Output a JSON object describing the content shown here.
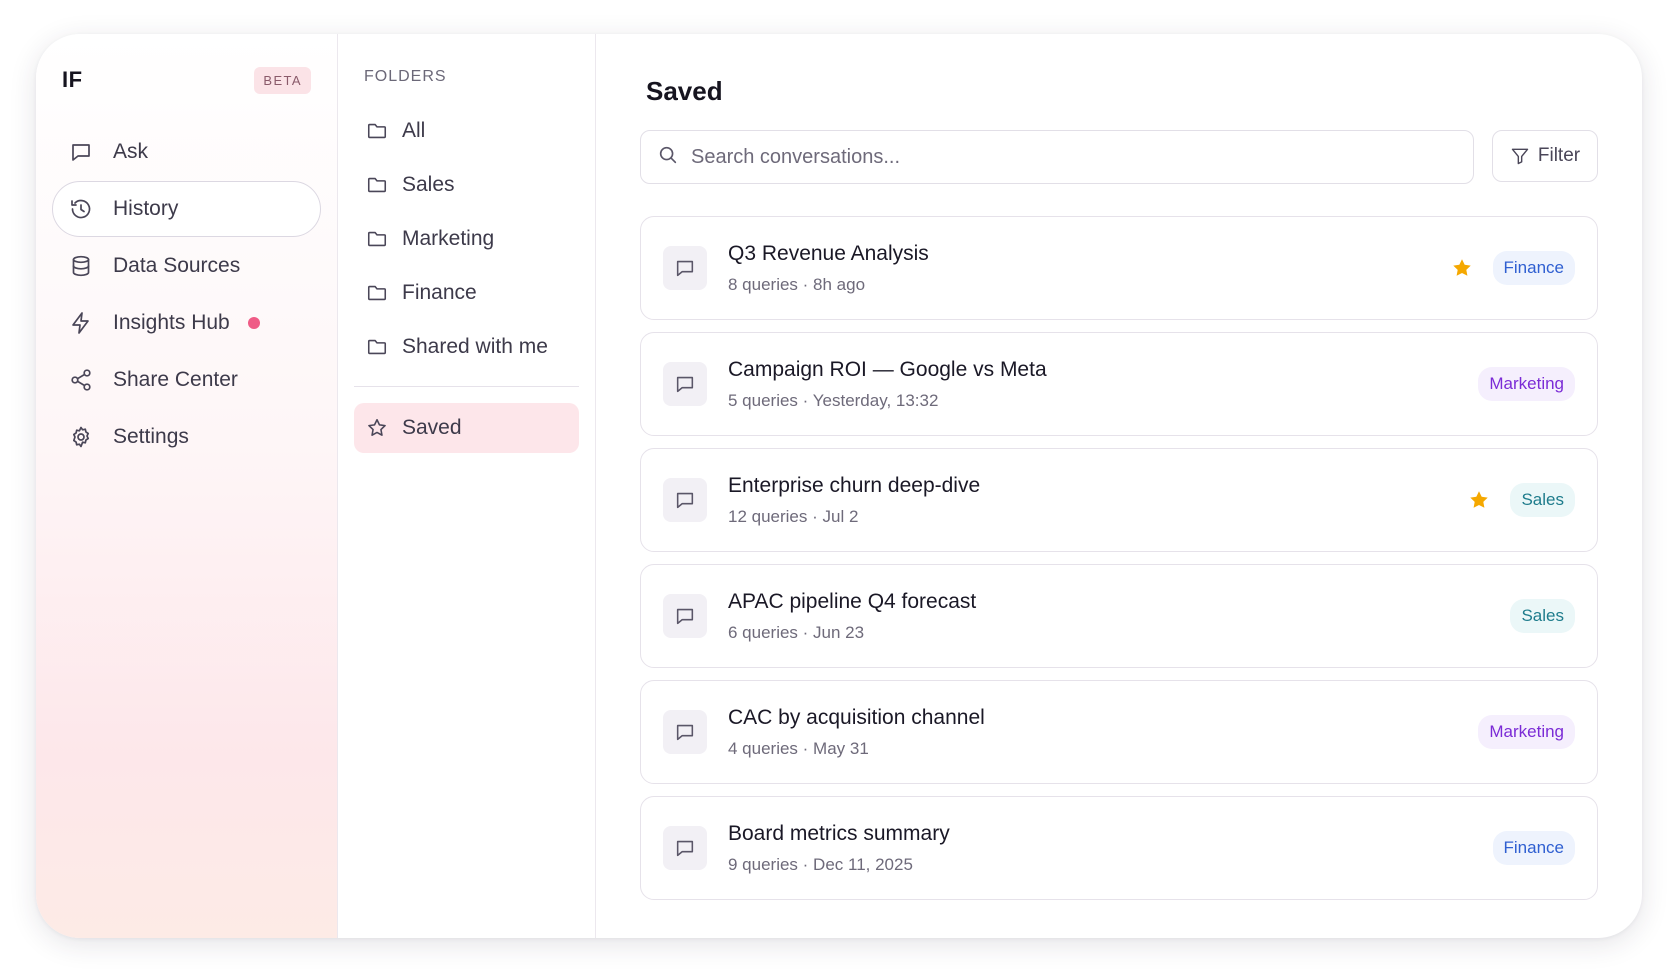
{
  "brand": {
    "logo": "IF",
    "badge": "BETA"
  },
  "sidebar": {
    "items": [
      {
        "label": "Ask",
        "icon": "chat-icon"
      },
      {
        "label": "History",
        "icon": "history-icon",
        "active": true
      },
      {
        "label": "Data Sources",
        "icon": "database-icon"
      },
      {
        "label": "Insights Hub",
        "icon": "lightning-icon",
        "notification": true
      },
      {
        "label": "Share Center",
        "icon": "share-icon"
      },
      {
        "label": "Settings",
        "icon": "gear-icon"
      }
    ]
  },
  "folders": {
    "header": "FOLDERS",
    "items": [
      {
        "label": "All",
        "icon": "folder-icon"
      },
      {
        "label": "Sales",
        "icon": "folder-icon"
      },
      {
        "label": "Marketing",
        "icon": "folder-icon"
      },
      {
        "label": "Finance",
        "icon": "folder-icon"
      },
      {
        "label": "Shared with me",
        "icon": "folder-icon"
      }
    ],
    "saved": {
      "label": "Saved",
      "icon": "star-outline-icon",
      "active": true
    }
  },
  "main": {
    "title": "Saved",
    "search": {
      "placeholder": "Search conversations..."
    },
    "filter_label": "Filter",
    "conversations": [
      {
        "title": "Q3 Revenue Analysis",
        "meta": "8 queries · 8h ago",
        "starred": true,
        "tag": "Finance"
      },
      {
        "title": "Campaign ROI — Google vs Meta",
        "meta": "5 queries · Yesterday, 13:32",
        "starred": false,
        "tag": "Marketing"
      },
      {
        "title": "Enterprise churn deep-dive",
        "meta": "12 queries · Jul 2",
        "starred": true,
        "tag": "Sales"
      },
      {
        "title": "APAC pipeline Q4 forecast",
        "meta": "6 queries · Jun 23",
        "starred": false,
        "tag": "Sales"
      },
      {
        "title": "CAC by acquisition channel",
        "meta": "4 queries · May 31",
        "starred": false,
        "tag": "Marketing"
      },
      {
        "title": "Board metrics summary",
        "meta": "9 queries · Dec 11, 2025",
        "starred": false,
        "tag": "Finance"
      }
    ]
  },
  "colors": {
    "accent_pink": "#fde6ea",
    "notification_dot": "#ef5b86",
    "star": "#f5a800",
    "tag_finance": "#2f5fd1",
    "tag_marketing": "#7b2bd6",
    "tag_sales": "#1e7c8c"
  }
}
